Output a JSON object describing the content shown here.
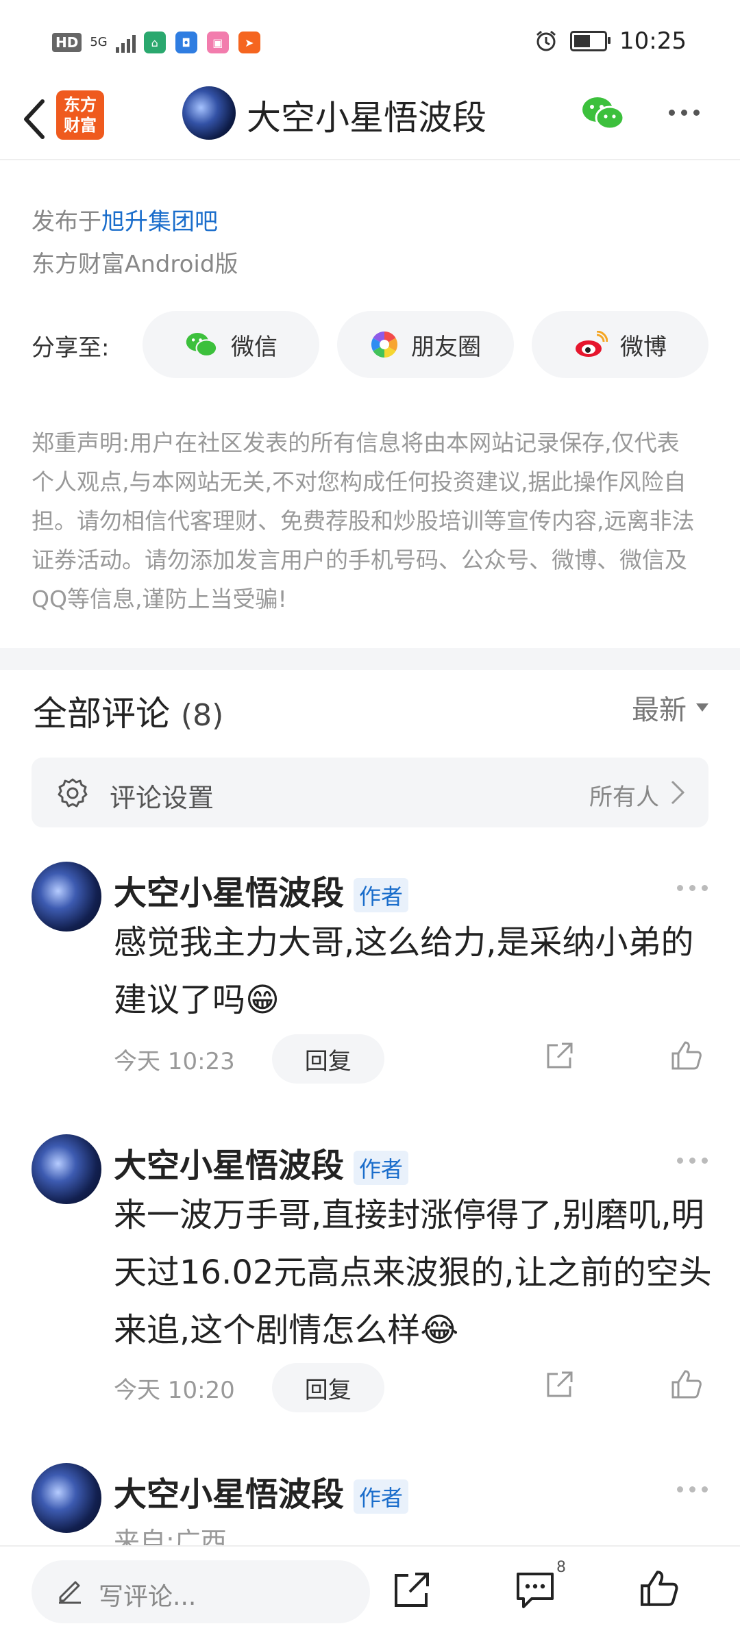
{
  "status_bar": {
    "hd": "HD",
    "network": "5G",
    "time": "10:25",
    "battery_level": 0.55,
    "apps": [
      {
        "icon": "home-app-icon",
        "color": "#2aa86e",
        "glyph": "⌂"
      },
      {
        "icon": "wallet-app-icon",
        "color": "#2f7de1",
        "glyph": "◘"
      },
      {
        "icon": "bilibili-app-icon",
        "color": "#f27cad",
        "glyph": "▣"
      },
      {
        "icon": "paper-plane-app-icon",
        "color": "#f5651f",
        "glyph": "➤"
      }
    ]
  },
  "header": {
    "logo_line1": "东方",
    "logo_line2": "财富",
    "title": "大空小星悟波段"
  },
  "post": {
    "published_prefix": "发布于",
    "published_link": "旭升集团吧",
    "platform": "东方财富Android版"
  },
  "share": {
    "label": "分享至:",
    "buttons": [
      {
        "label": "微信",
        "icon": "wechat-icon"
      },
      {
        "label": "朋友圈",
        "icon": "moments-icon"
      },
      {
        "label": "微博",
        "icon": "weibo-icon"
      }
    ]
  },
  "disclaimer": "郑重声明:用户在社区发表的所有信息将由本网站记录保存,仅代表个人观点,与本网站无关,不对您构成任何投资建议,据此操作风险自担。请勿相信代客理财、免费荐股和炒股培训等宣传内容,远离非法证券活动。请勿添加发言用户的手机号码、公众号、微博、微信及QQ等信息,谨防上当受骗!",
  "comments_section": {
    "title": "全部评论",
    "count": "(8)",
    "sort_label": "最新",
    "settings_label": "评论设置",
    "settings_value": "所有人"
  },
  "comments": [
    {
      "author": "大空小星悟波段",
      "badge": "作者",
      "text": "感觉我主力大哥,这么给力,是采纳小弟的建议了吗😁",
      "time": "今天 10:23",
      "reply_label": "回复"
    },
    {
      "author": "大空小星悟波段",
      "badge": "作者",
      "text": "来一波万手哥,直接封涨停得了,别磨叽,明天过16.02元高点来波狠的,让之前的空头来追,这个剧情怎么样😂",
      "time": "今天 10:20",
      "reply_label": "回复"
    },
    {
      "author": "大空小星悟波段",
      "badge": "作者",
      "location": "来自:广西"
    }
  ],
  "bottom_bar": {
    "placeholder": "写评论...",
    "comment_count": "8"
  }
}
